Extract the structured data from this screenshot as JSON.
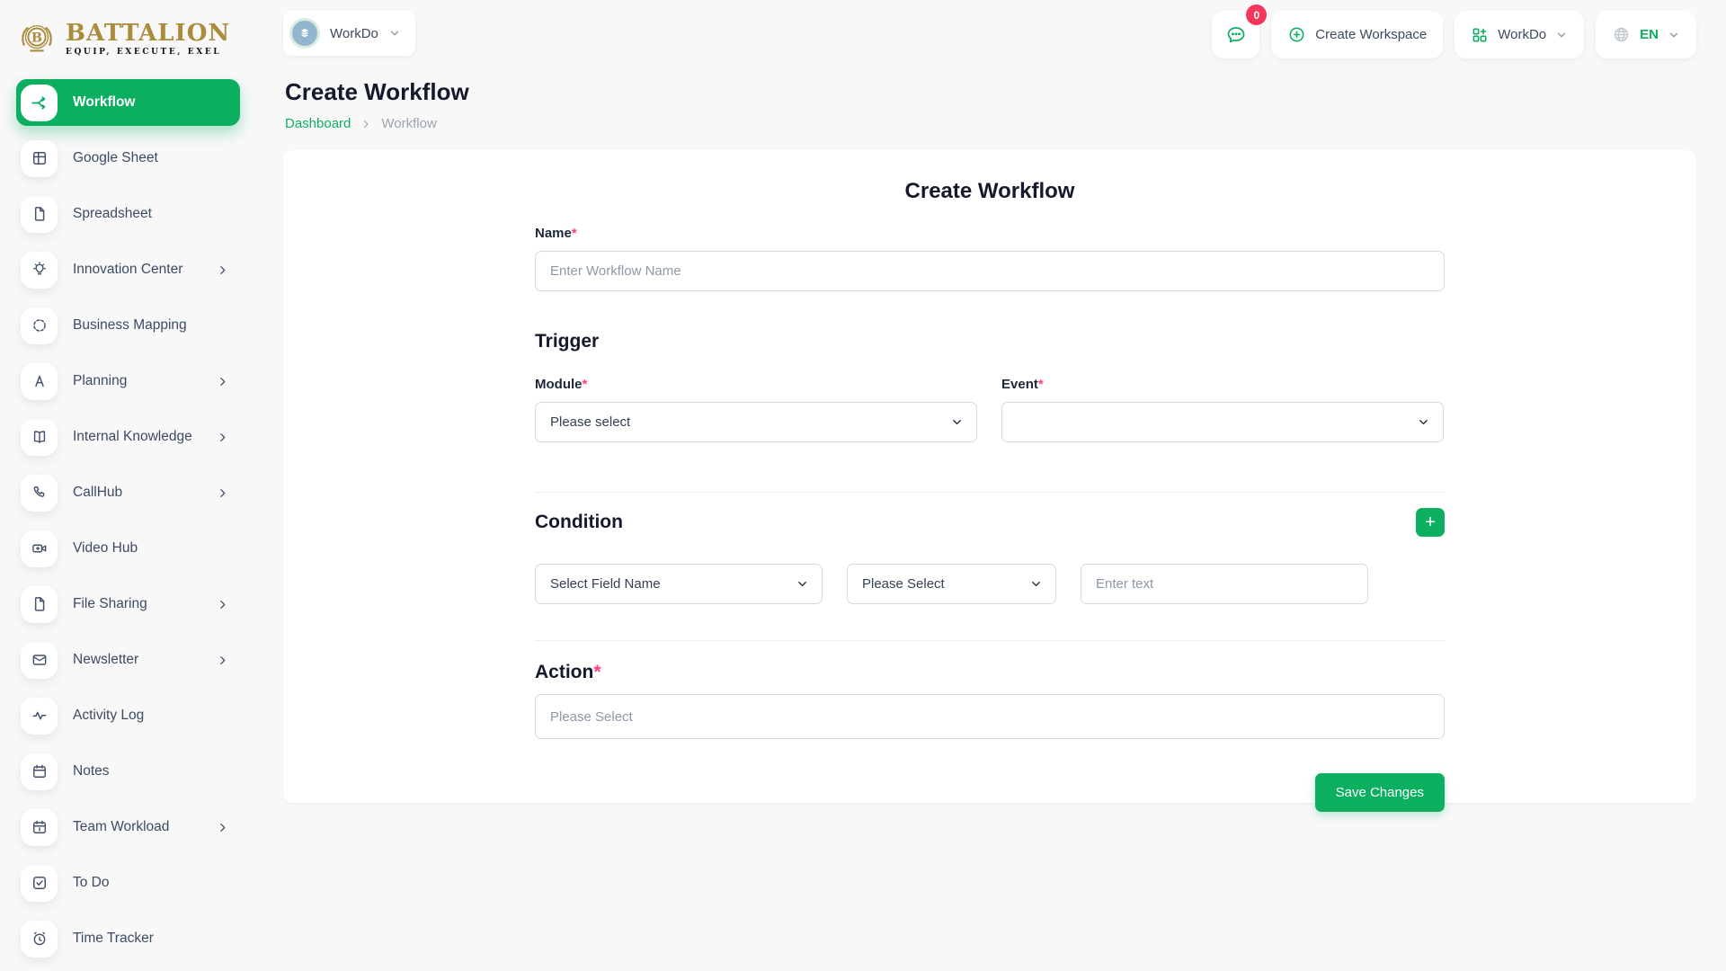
{
  "brand": {
    "name": "BATTALION",
    "tagline": "EQUIP, EXECUTE, EXEL",
    "monogram": "B"
  },
  "topbar": {
    "workspace": "WorkDo",
    "messages_badge": "0",
    "create_workspace_label": "Create Workspace",
    "apps_menu_label": "WorkDo",
    "language": "EN"
  },
  "sidebar": {
    "items": [
      {
        "label": "Workflow",
        "icon": "workflow-icon",
        "active": true
      },
      {
        "label": "Google Sheet",
        "icon": "table-icon"
      },
      {
        "label": "Spreadsheet",
        "icon": "file-icon"
      },
      {
        "label": "Innovation Center",
        "icon": "lightbulb-icon",
        "expandable": true
      },
      {
        "label": "Business Mapping",
        "icon": "dashed-circle-icon"
      },
      {
        "label": "Planning",
        "icon": "letter-a-icon",
        "expandable": true
      },
      {
        "label": "Internal Knowledge",
        "icon": "open-book-icon",
        "expandable": true
      },
      {
        "label": "CallHub",
        "icon": "phone-icon",
        "expandable": true
      },
      {
        "label": "Video Hub",
        "icon": "video-camera-icon"
      },
      {
        "label": "File Sharing",
        "icon": "file-icon",
        "expandable": true
      },
      {
        "label": "Newsletter",
        "icon": "envelope-icon",
        "expandable": true
      },
      {
        "label": "Activity Log",
        "icon": "activity-icon"
      },
      {
        "label": "Notes",
        "icon": "calendar-icon"
      },
      {
        "label": "Team Workload",
        "icon": "calendar-icon",
        "expandable": true
      },
      {
        "label": "To Do",
        "icon": "check-square-icon"
      },
      {
        "label": "Time Tracker",
        "icon": "alarm-clock-icon"
      }
    ]
  },
  "page": {
    "title": "Create Workflow",
    "breadcrumb": {
      "root": "Dashboard",
      "current": "Workflow"
    }
  },
  "form": {
    "title": "Create Workflow",
    "required_marker": "*",
    "name": {
      "label": "Name",
      "placeholder": "Enter Workflow Name",
      "value": ""
    },
    "trigger": {
      "heading": "Trigger",
      "module": {
        "label": "Module",
        "selected": "Please select"
      },
      "event": {
        "label": "Event",
        "selected": ""
      }
    },
    "condition": {
      "heading": "Condition",
      "add_label": "+",
      "field_select": "Select Field Name",
      "operator_select": "Please Select",
      "value_placeholder": "Enter text",
      "value": ""
    },
    "action": {
      "heading": "Action",
      "placeholder": "Please Select",
      "value": ""
    },
    "save_label": "Save Changes"
  },
  "colors": {
    "accent_green": "#0CAF60",
    "badge_pink": "#F5365C",
    "brand_gold": "#AB8C3C"
  }
}
